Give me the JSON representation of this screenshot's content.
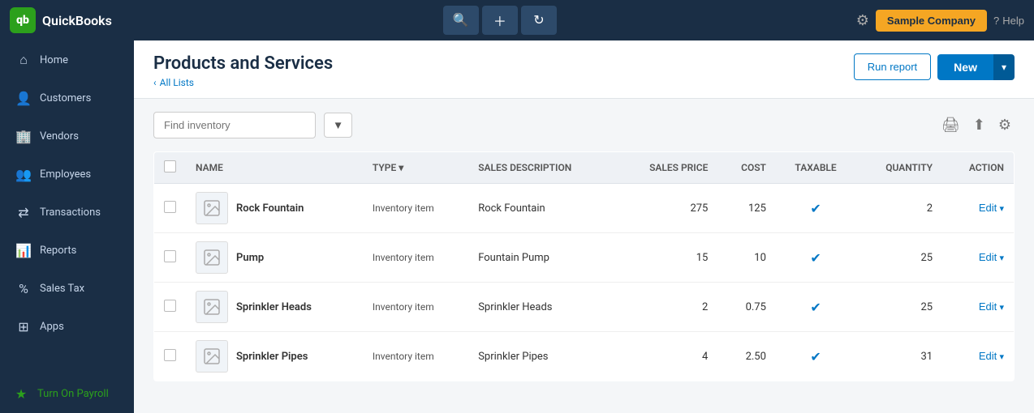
{
  "app": {
    "logo_text": "QuickBooks",
    "logo_abbr": "qb"
  },
  "topbar": {
    "search_icon": "🔍",
    "add_icon": "+",
    "refresh_icon": "↻",
    "gear_icon": "⚙",
    "company_name": "Sample Company",
    "help_icon": "?",
    "help_label": "Help"
  },
  "sidebar": {
    "items": [
      {
        "id": "home",
        "label": "Home",
        "icon": "⌂"
      },
      {
        "id": "customers",
        "label": "Customers",
        "icon": "👤"
      },
      {
        "id": "vendors",
        "label": "Vendors",
        "icon": "🏢"
      },
      {
        "id": "employees",
        "label": "Employees",
        "icon": "👥"
      },
      {
        "id": "transactions",
        "label": "Transactions",
        "icon": "⇄"
      },
      {
        "id": "reports",
        "label": "Reports",
        "icon": "📊"
      },
      {
        "id": "sales-tax",
        "label": "Sales Tax",
        "icon": "%"
      },
      {
        "id": "apps",
        "label": "Apps",
        "icon": "⊞"
      }
    ],
    "special": {
      "id": "turn-on-payroll",
      "label": "Turn On Payroll",
      "icon": "★"
    }
  },
  "page": {
    "title": "Products and Services",
    "breadcrumb_icon": "‹",
    "breadcrumb_label": "All Lists",
    "run_report_label": "Run report",
    "new_label": "New"
  },
  "toolbar": {
    "search_placeholder": "Find inventory",
    "filter_icon": "▾",
    "print_icon": "🖨",
    "export_icon": "⬆",
    "settings_icon": "⚙"
  },
  "table": {
    "columns": [
      {
        "id": "name",
        "label": "NAME"
      },
      {
        "id": "type",
        "label": "TYPE"
      },
      {
        "id": "sales_description",
        "label": "SALES DESCRIPTION"
      },
      {
        "id": "sales_price",
        "label": "SALES PRICE"
      },
      {
        "id": "cost",
        "label": "COST"
      },
      {
        "id": "taxable",
        "label": "TAXABLE"
      },
      {
        "id": "quantity",
        "label": "QUANTITY"
      },
      {
        "id": "action",
        "label": "ACTION"
      }
    ],
    "rows": [
      {
        "name": "Rock Fountain",
        "type": "Inventory item",
        "sales_description": "Rock Fountain",
        "sales_price": "275",
        "cost": "125",
        "taxable": true,
        "quantity": "2",
        "action_label": "Edit"
      },
      {
        "name": "Pump",
        "type": "Inventory item",
        "sales_description": "Fountain Pump",
        "sales_price": "15",
        "cost": "10",
        "taxable": true,
        "quantity": "25",
        "action_label": "Edit"
      },
      {
        "name": "Sprinkler Heads",
        "type": "Inventory item",
        "sales_description": "Sprinkler Heads",
        "sales_price": "2",
        "cost": "0.75",
        "taxable": true,
        "quantity": "25",
        "action_label": "Edit"
      },
      {
        "name": "Sprinkler Pipes",
        "type": "Inventory item",
        "sales_description": "Sprinkler Pipes",
        "sales_price": "4",
        "cost": "2.50",
        "taxable": true,
        "quantity": "31",
        "action_label": "Edit"
      }
    ]
  }
}
